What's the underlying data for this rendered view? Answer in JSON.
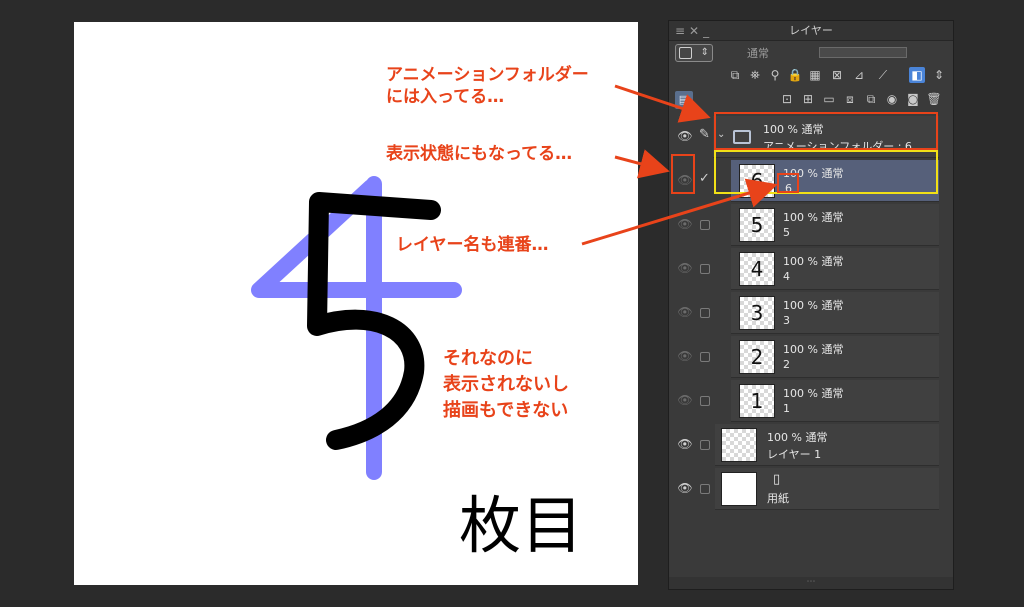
{
  "annotations": {
    "a1_line1": "アニメーションフォルダー",
    "a1_line2": "には入ってる…",
    "a2": "表示状態にもなってる…",
    "a3": "レイヤー名も連番…",
    "a4_line1": "それなのに",
    "a4_line2": "表示されないし",
    "a4_line3": "描画もできない"
  },
  "canvas": {
    "drawn_number": "5",
    "drawn_text": "枚目",
    "stroke_black": "#000000",
    "stroke_purple": "#8080ff"
  },
  "panel": {
    "title": "レイヤー",
    "blend_mode": "通常",
    "folder": {
      "line1": "100 % 通常",
      "line2": "アニメーションフォルダー : 6"
    },
    "layers": [
      {
        "thumb": "6",
        "line1": "100 % 通常",
        "line2": "6"
      },
      {
        "thumb": "5",
        "line1": "100 % 通常",
        "line2": "5"
      },
      {
        "thumb": "4",
        "line1": "100 % 通常",
        "line2": "4"
      },
      {
        "thumb": "3",
        "line1": "100 % 通常",
        "line2": "3"
      },
      {
        "thumb": "2",
        "line1": "100 % 通常",
        "line2": "2"
      },
      {
        "thumb": "1",
        "line1": "100 % 通常",
        "line2": "1"
      }
    ],
    "layer1": {
      "line1": "100 % 通常",
      "line2": "レイヤー 1"
    },
    "paper": {
      "line2": "用紙"
    }
  },
  "colors": {
    "annotation_red": "#e8431a",
    "highlight_yellow": "#f1e017",
    "selected_row": "#56607a"
  }
}
